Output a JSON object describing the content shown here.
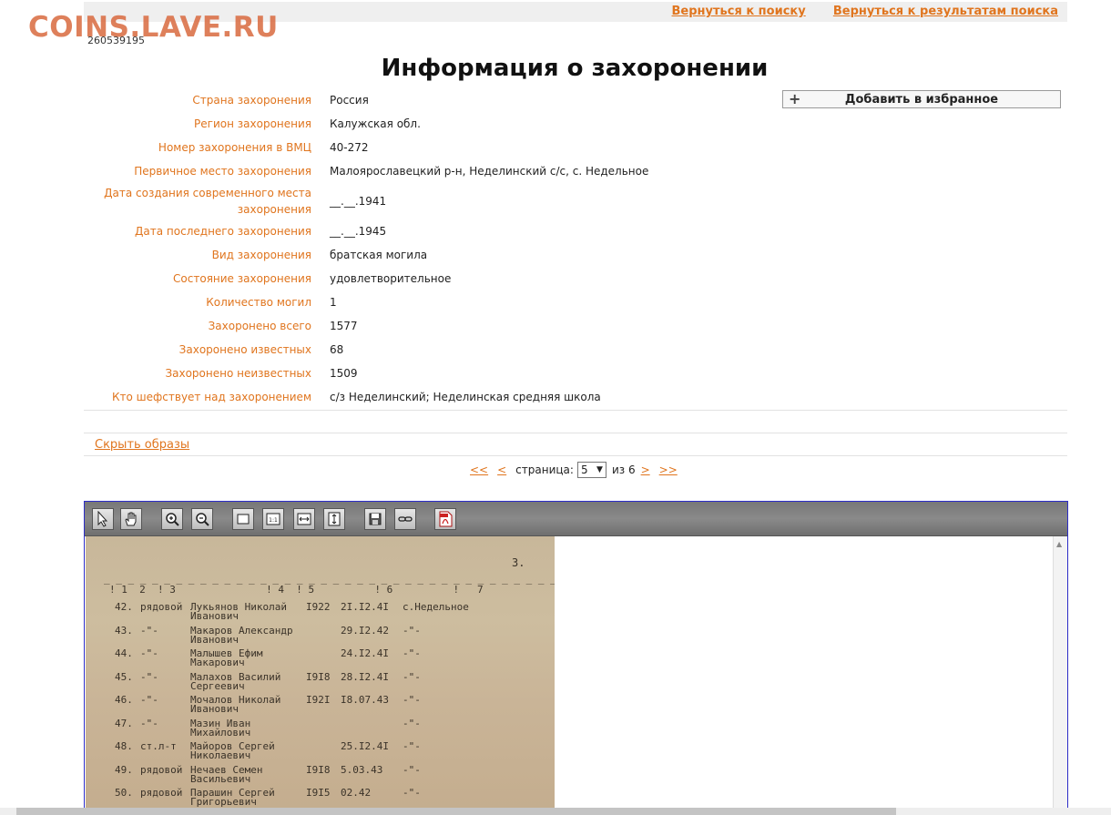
{
  "watermark": "COINS.LAVE.RU",
  "nav": {
    "back_search": "Вернуться к поиску",
    "back_results": "Вернуться к результатам поиска"
  },
  "record_id": "260539195",
  "title": "Информация о захоронении",
  "fields": [
    {
      "label": "Страна захоронения",
      "value": "Россия"
    },
    {
      "label": "Регион захоронения",
      "value": "Калужская обл."
    },
    {
      "label": "Номер захоронения в ВМЦ",
      "value": "40-272"
    },
    {
      "label": "Первичное место захоронения",
      "value": "Малоярославецкий р-н, Неделинский с/с, с. Недельное"
    },
    {
      "label": "Дата создания современного места захоронения",
      "value": "__.__.1941"
    },
    {
      "label": "Дата последнего захоронения",
      "value": "__.__.1945"
    },
    {
      "label": "Вид захоронения",
      "value": "братская могила"
    },
    {
      "label": "Состояние захоронения",
      "value": "удовлетворительное"
    },
    {
      "label": "Количество могил",
      "value": "1"
    },
    {
      "label": "Захоронено всего",
      "value": "1577"
    },
    {
      "label": "Захоронено известных",
      "value": "68"
    },
    {
      "label": "Захоронено неизвестных",
      "value": "1509"
    },
    {
      "label": "Кто шефствует над захоронением",
      "value": "с/з Неделинский; Неделинская средняя школа"
    }
  ],
  "favorite": {
    "icon": "plus-icon",
    "label": "Добавить в избранное"
  },
  "hide_images": "Скрыть образы",
  "pager": {
    "first": "<<",
    "prev": "<",
    "label": "страница:",
    "current": "5",
    "of_label": "из 6",
    "next": ">",
    "last": ">>"
  },
  "toolbar": {
    "icons": [
      "select-arrow-icon",
      "hand-pan-icon",
      "zoom-in-icon",
      "zoom-out-icon",
      "fit-page-icon",
      "actual-size-icon",
      "fit-width-icon",
      "fit-height-icon",
      "save-icon",
      "link-icon",
      "pdf-icon"
    ]
  },
  "document": {
    "page_number": "3.",
    "column_header": "! 1  2  ! 3               ! 4  ! 5          ! 6          !   7",
    "records": [
      {
        "n": "42.",
        "rank": "рядовой",
        "name": "Лукьянов Николай",
        "patronymic": "Иванович",
        "year": "I922",
        "date": "2I.I2.4I",
        "place": "с.Недельное"
      },
      {
        "n": "43.",
        "rank": "-\"-",
        "name": "Макаров Александр",
        "patronymic": "Иванович",
        "year": "",
        "date": "29.I2.42",
        "place": "-\"-"
      },
      {
        "n": "44.",
        "rank": "-\"-",
        "name": "Малышев Ефим",
        "patronymic": "Макарович",
        "year": "",
        "date": "24.I2.4I",
        "place": "-\"-"
      },
      {
        "n": "45.",
        "rank": "-\"-",
        "name": "Малахов Василий",
        "patronymic": "Сергеевич",
        "year": "I9I8",
        "date": "28.I2.4I",
        "place": "-\"-"
      },
      {
        "n": "46.",
        "rank": "-\"-",
        "name": "Мочалов Николай",
        "patronymic": "Иванович",
        "year": "I92I",
        "date": "I8.07.43",
        "place": "-\"-"
      },
      {
        "n": "47.",
        "rank": "-\"-",
        "name": "Мазин Иван",
        "patronymic": "Михайлович",
        "year": "",
        "date": "",
        "place": "-\"-"
      },
      {
        "n": "48.",
        "rank": "ст.л-т",
        "name": "Майоров Сергей",
        "patronymic": "Николаевич",
        "year": "",
        "date": "25.I2.4I",
        "place": "-\"-"
      },
      {
        "n": "49.",
        "rank": "рядовой",
        "name": "Нечаев Семен",
        "patronymic": "Васильевич",
        "year": "I9I8",
        "date": "5.03.43",
        "place": "-\"-"
      },
      {
        "n": "50.",
        "rank": "рядовой",
        "name": "Парашин Сергей",
        "patronymic": "Григорьевич",
        "year": "I9I5",
        "date": "02.42",
        "place": "-\"-"
      }
    ]
  }
}
